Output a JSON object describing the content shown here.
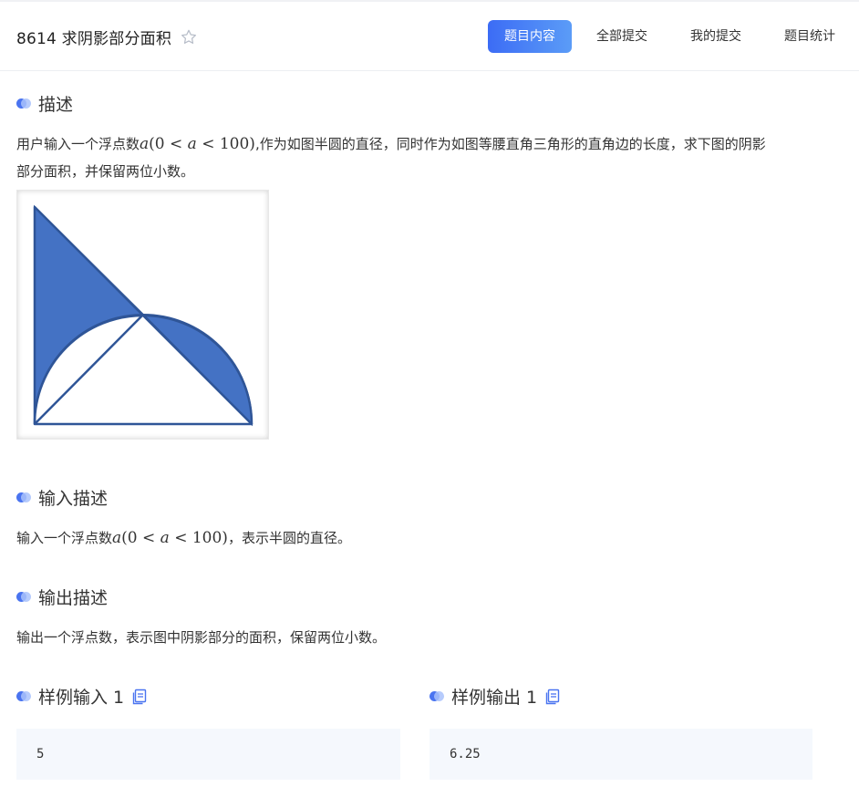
{
  "header": {
    "title": "8614 求阴影部分面积",
    "tabs": [
      {
        "label": "题目内容",
        "active": true
      },
      {
        "label": "全部提交",
        "active": false
      },
      {
        "label": "我的提交",
        "active": false
      },
      {
        "label": "题目统计",
        "active": false
      }
    ]
  },
  "description": {
    "heading": "描述",
    "text_before_math": "用户输入一个浮点数",
    "math_var": "a",
    "math_expr_open": "(0 < ",
    "math_expr_close": " < 100)",
    "text_after_math": ",作为如图半圆的直径，同时作为如图等腰直角三角形的直角边的长度，求下图的阴影",
    "text_line2": "部分面积，并保留两位小数。"
  },
  "input_desc": {
    "heading": "输入描述",
    "text_before_math": "输入一个浮点数",
    "math_var": "a",
    "math_expr_open": "(0 < ",
    "math_expr_close": " < 100)",
    "text_after_math": "，表示半圆的直径。"
  },
  "output_desc": {
    "heading": "输出描述",
    "text": "输出一个浮点数，表示图中阴影部分的面积，保留两位小数。"
  },
  "samples": {
    "input_heading": "样例输入 1",
    "output_heading": "样例输出 1",
    "input_value": "5",
    "output_value": "6.25"
  },
  "colors": {
    "accent": "#3c6cf5",
    "shade": "#4472c4",
    "shade_stroke": "#2f5597",
    "code_bg": "#f5f8fd"
  },
  "icons": {
    "favorite": "star-outline-icon",
    "copy": "copy-icon",
    "bullet": "double-dot-icon"
  }
}
